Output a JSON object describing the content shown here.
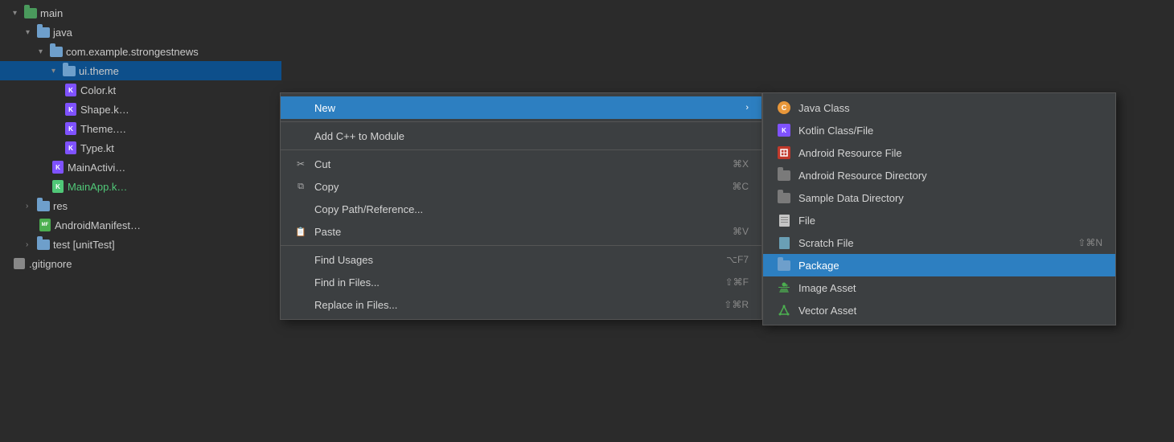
{
  "tree": {
    "items": [
      {
        "id": "main",
        "label": "main",
        "indent": 0,
        "type": "folder-green",
        "expanded": true,
        "arrow": "▾"
      },
      {
        "id": "java",
        "label": "java",
        "indent": 1,
        "type": "folder-blue",
        "expanded": true,
        "arrow": "▾"
      },
      {
        "id": "com.example",
        "label": "com.example.strongestnews",
        "indent": 2,
        "type": "folder-blue",
        "expanded": true,
        "arrow": "▾"
      },
      {
        "id": "ui.theme",
        "label": "ui.theme",
        "indent": 3,
        "type": "folder-blue",
        "expanded": true,
        "arrow": "▾",
        "selected": true
      },
      {
        "id": "Color.kt",
        "label": "Color.kt",
        "indent": 4,
        "type": "kt"
      },
      {
        "id": "Shape.kt",
        "label": "Shape.k…",
        "indent": 4,
        "type": "kt"
      },
      {
        "id": "Theme.kt",
        "label": "Theme.…",
        "indent": 4,
        "type": "kt"
      },
      {
        "id": "Type.kt",
        "label": "Type.kt",
        "indent": 4,
        "type": "kt"
      },
      {
        "id": "MainActivity",
        "label": "MainActivi…",
        "indent": 3,
        "type": "kt"
      },
      {
        "id": "MainApp",
        "label": "MainApp.k…",
        "indent": 3,
        "type": "kt-green"
      },
      {
        "id": "res",
        "label": "res",
        "indent": 1,
        "type": "folder-blue",
        "expanded": false,
        "arrow": "›"
      },
      {
        "id": "AndroidManifest",
        "label": "AndroidManifest…",
        "indent": 2,
        "type": "manifest"
      },
      {
        "id": "test",
        "label": "test [unitTest]",
        "indent": 1,
        "type": "folder-blue",
        "expanded": false,
        "arrow": "›"
      },
      {
        "id": "gitignore",
        "label": ".gitignore",
        "indent": 0,
        "type": "file"
      }
    ]
  },
  "context_menu": {
    "items": [
      {
        "id": "new",
        "label": "New",
        "shortcut": "",
        "arrow": "›",
        "highlighted": true,
        "icon": "none"
      },
      {
        "id": "sep1",
        "type": "separator"
      },
      {
        "id": "add-cpp",
        "label": "Add C++ to Module",
        "shortcut": "",
        "icon": "none"
      },
      {
        "id": "sep2",
        "type": "separator"
      },
      {
        "id": "cut",
        "label": "Cut",
        "shortcut": "⌘X",
        "icon": "scissors"
      },
      {
        "id": "copy",
        "label": "Copy",
        "shortcut": "⌘C",
        "icon": "copy"
      },
      {
        "id": "copy-path",
        "label": "Copy Path/Reference...",
        "shortcut": "",
        "icon": "none"
      },
      {
        "id": "paste",
        "label": "Paste",
        "shortcut": "⌘V",
        "icon": "paste"
      },
      {
        "id": "sep3",
        "type": "separator"
      },
      {
        "id": "find-usages",
        "label": "Find Usages",
        "shortcut": "⌥F7",
        "icon": "none"
      },
      {
        "id": "find-files",
        "label": "Find in Files...",
        "shortcut": "⇧⌘F",
        "icon": "none"
      },
      {
        "id": "replace-files",
        "label": "Replace in Files...",
        "shortcut": "⇧⌘R",
        "icon": "none"
      }
    ]
  },
  "submenu": {
    "items": [
      {
        "id": "java-class",
        "label": "Java Class",
        "icon": "java-class",
        "shortcut": ""
      },
      {
        "id": "kotlin-class",
        "label": "Kotlin Class/File",
        "icon": "kotlin",
        "shortcut": ""
      },
      {
        "id": "android-res-file",
        "label": "Android Resource File",
        "icon": "android-res-file",
        "shortcut": ""
      },
      {
        "id": "android-res-dir",
        "label": "Android Resource Directory",
        "icon": "android-res-dir",
        "shortcut": ""
      },
      {
        "id": "sample-data-dir",
        "label": "Sample Data Directory",
        "icon": "sample-dir",
        "shortcut": ""
      },
      {
        "id": "file",
        "label": "File",
        "icon": "file-plain",
        "shortcut": ""
      },
      {
        "id": "scratch-file",
        "label": "Scratch File",
        "icon": "scratch",
        "shortcut": "⇧⌘N"
      },
      {
        "id": "package",
        "label": "Package",
        "icon": "package",
        "highlighted": true,
        "shortcut": ""
      },
      {
        "id": "image-asset",
        "label": "Image Asset",
        "icon": "image-asset",
        "shortcut": ""
      },
      {
        "id": "vector-asset",
        "label": "Vector Asset",
        "icon": "vector-asset",
        "shortcut": ""
      }
    ]
  }
}
